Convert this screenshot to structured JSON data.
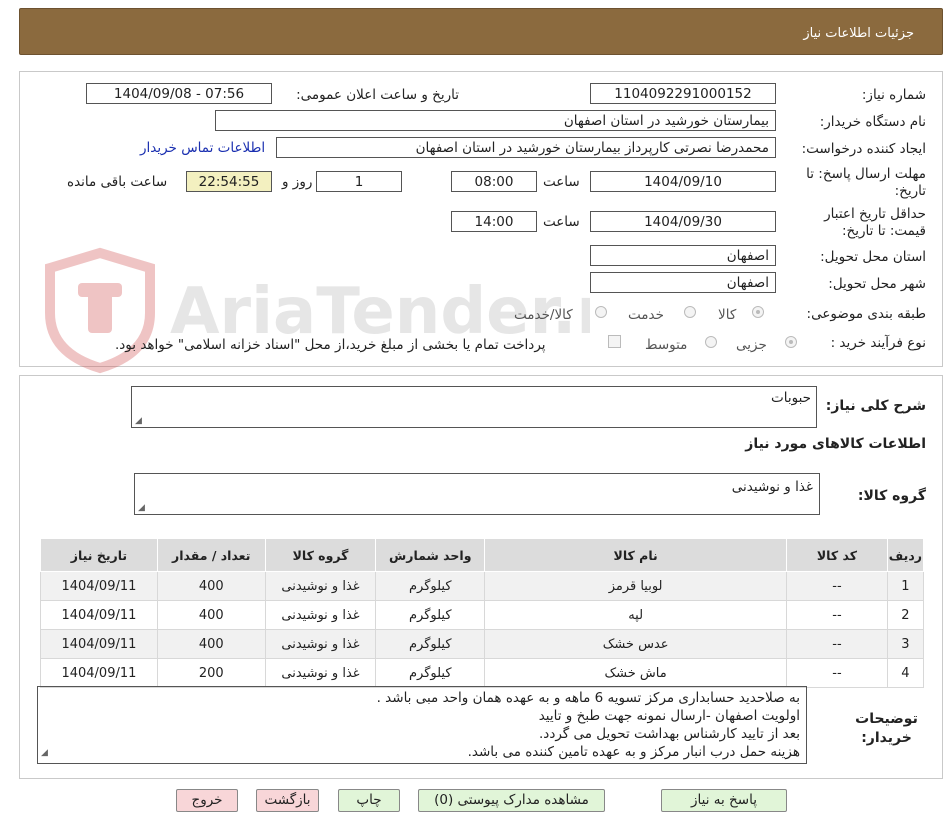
{
  "header": {
    "title": "جزئیات اطلاعات نیاز"
  },
  "watermark": {
    "text": "AriaTender.neT"
  },
  "form": {
    "need_number": {
      "label": "شماره نیاز:",
      "value": "1104092291000152"
    },
    "announce": {
      "label": "تاریخ و ساعت اعلان عمومی:",
      "value": "1404/09/08 - 07:56"
    },
    "buyer_org": {
      "label": "نام دستگاه خریدار:",
      "value": "بیمارستان خورشید در استان اصفهان"
    },
    "requester": {
      "label": "ایجاد کننده درخواست:",
      "value": "محمدرضا نصرتی کارپرداز بیمارستان خورشید در استان اصفهان",
      "contact_link": "اطلاعات تماس خریدار"
    },
    "deadline": {
      "label": "مهلت ارسال پاسخ: تا تاریخ:",
      "date": "1404/09/10",
      "time_label": "ساعت",
      "time": "08:00",
      "days": "1",
      "days_label": "روز و",
      "remaining": "22:54:55",
      "remaining_label": "ساعت باقی مانده"
    },
    "validity": {
      "label": "حداقل تاریخ اعتبار قیمت: تا تاریخ:",
      "date": "1404/09/30",
      "time_label": "ساعت",
      "time": "14:00"
    },
    "province": {
      "label": "استان محل تحویل:",
      "value": "اصفهان"
    },
    "city": {
      "label": "شهر محل تحویل:",
      "value": "اصفهان"
    },
    "category": {
      "label": "طبقه بندی موضوعی:",
      "options": [
        "کالا",
        "خدمت",
        "کالا/خدمت"
      ],
      "selected": "کالا"
    },
    "process": {
      "label": "نوع فرآیند خرید :",
      "options": [
        "جزیی",
        "متوسط"
      ],
      "selected": "جزیی",
      "payment_note": "پرداخت تمام یا بخشی از مبلغ خرید،از محل \"اسناد خزانه اسلامی\" خواهد بود."
    }
  },
  "summary": {
    "label": "شرح کلی نیاز:",
    "value": "حبوبات"
  },
  "goods_section": {
    "title": "اطلاعات کالاهای مورد نیاز"
  },
  "goods_group": {
    "label": "گروه کالا:",
    "value": "غذا و نوشیدنی"
  },
  "table": {
    "headers": [
      "ردیف",
      "کد کالا",
      "نام کالا",
      "واحد شمارش",
      "گروه کالا",
      "تعداد / مقدار",
      "تاریخ نیاز"
    ],
    "rows": [
      [
        "1",
        "--",
        "لوبیا قرمز",
        "کیلوگرم",
        "غذا و نوشیدنی",
        "400",
        "1404/09/11"
      ],
      [
        "2",
        "--",
        "لپه",
        "کیلوگرم",
        "غذا و نوشیدنی",
        "400",
        "1404/09/11"
      ],
      [
        "3",
        "--",
        "عدس خشک",
        "کیلوگرم",
        "غذا و نوشیدنی",
        "400",
        "1404/09/11"
      ],
      [
        "4",
        "--",
        "ماش خشک",
        "کیلوگرم",
        "غذا و نوشیدنی",
        "200",
        "1404/09/11"
      ]
    ]
  },
  "buyer_notes": {
    "label": "توضیحات خریدار:",
    "lines": [
      "به صلاحدید حسابداری مرکز تسویه 6 ماهه و به عهده همان واحد مبی باشد .",
      "اولویت اصفهان -ارسال نمونه جهت طبخ و تایید",
      "بعد از تایید کارشناس بهداشت تحویل می گردد.",
      "هزینه حمل درب انبار مرکز و به عهده تامین کننده می باشد."
    ]
  },
  "buttons": {
    "reply": "پاسخ به نیاز",
    "attachments": "مشاهده مدارک پیوستی (0)",
    "print": "چاپ",
    "back": "بازگشت",
    "exit": "خروج"
  },
  "colors": {
    "header_bg": "#8b6a3e",
    "contact_link": "#1a2fb0",
    "remaining_bg": "#f3f0c0",
    "green_button": "#e1f5d8",
    "pink_button": "#f8d6d8"
  }
}
